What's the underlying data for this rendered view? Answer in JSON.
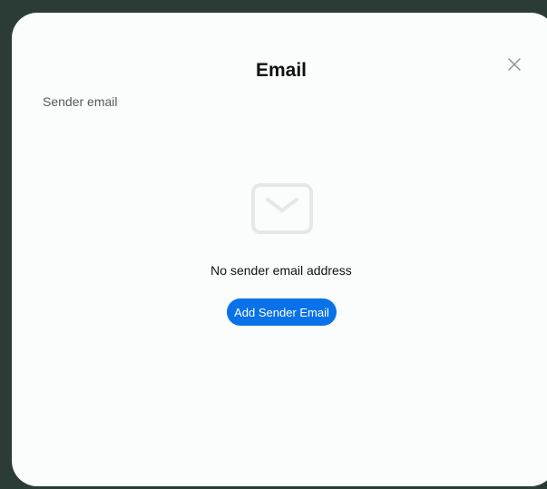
{
  "dialog": {
    "title": "Email",
    "section_label": "Sender email",
    "empty_state": {
      "icon": "envelope-icon",
      "message": "No sender email address"
    },
    "add_button_label": "Add Sender Email",
    "close_icon": "close-icon"
  },
  "colors": {
    "backdrop": "#2b3c37",
    "dialog_background": "#fbfcfc",
    "accent": "#0a72e8",
    "icon_muted": "#e6e7e6"
  }
}
